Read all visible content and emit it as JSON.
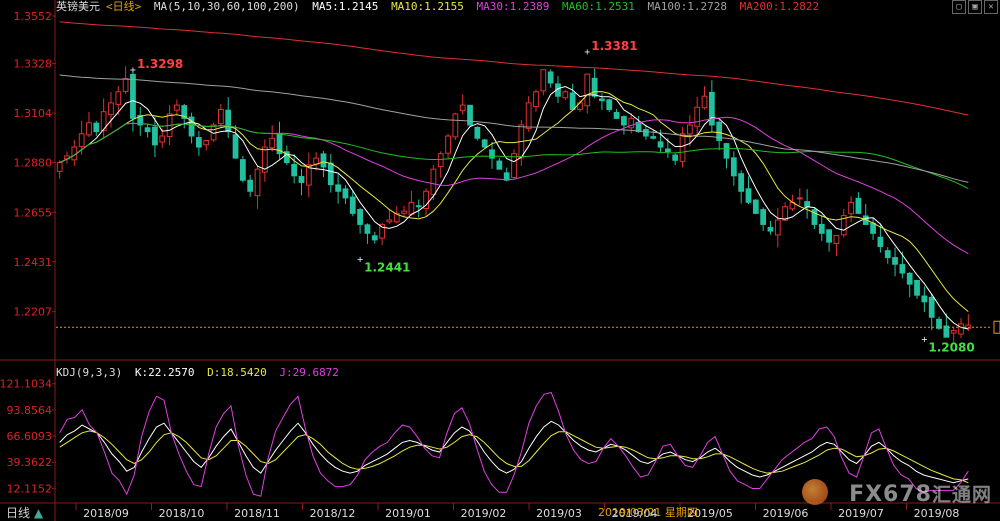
{
  "window": {
    "instrument": "英镑美元",
    "period": "<日线>",
    "controls": [
      "▢",
      "▣",
      "✕"
    ]
  },
  "ma_legend": {
    "header": "MA(5,10,30,60,100,200)",
    "items": [
      {
        "label": "MA5:1.2145",
        "color": "#ffffff"
      },
      {
        "label": "MA10:1.2155",
        "color": "#e8e840"
      },
      {
        "label": "MA30:1.2389",
        "color": "#e040e0"
      },
      {
        "label": "MA60:1.2531",
        "color": "#20c020"
      },
      {
        "label": "MA100:1.2728",
        "color": "#a0a0a0"
      },
      {
        "label": "MA200:1.2822",
        "color": "#e03030"
      }
    ]
  },
  "kdj_legend": {
    "header": "KDJ(9,3,3)",
    "items": [
      {
        "label": "K:22.2570",
        "color": "#ffffff"
      },
      {
        "label": "D:18.5420",
        "color": "#e8e840"
      },
      {
        "label": "J:29.6872",
        "color": "#e040e0"
      }
    ]
  },
  "bottom_bar": {
    "period_label": "日线",
    "cursor_date": "2019/03/21",
    "cursor_weekday": "星期四"
  },
  "watermark": {
    "text": "FX678",
    "cn": "汇通网"
  },
  "chart_data": [
    {
      "type": "candlestick",
      "title": "英镑美元",
      "y_ticks": [
        1.3552,
        1.3328,
        1.3104,
        1.288,
        1.2655,
        1.2431,
        1.2207
      ],
      "ylim": [
        1.205,
        1.3552
      ],
      "x_ticks": [
        "2018/09",
        "2018/10",
        "2018/11",
        "2018/12",
        "2019/01",
        "2019/02",
        "2019/03",
        "2019/04",
        "2019/05",
        "2019/06",
        "2019/07",
        "2019/08"
      ],
      "annotations": [
        {
          "label": "1.3298",
          "date": "2018/09 end",
          "type": "high"
        },
        {
          "label": "1.2441",
          "date": "2019/01 start",
          "type": "low"
        },
        {
          "label": "1.3381",
          "date": "2019/03 mid",
          "type": "high"
        },
        {
          "label": "1.2080",
          "date": "2019/08",
          "type": "low"
        }
      ],
      "current_price_line": 1.2135,
      "close": [
        1.288,
        1.291,
        1.295,
        1.301,
        1.306,
        1.302,
        1.311,
        1.315,
        1.32,
        1.326,
        1.308,
        1.305,
        1.302,
        1.296,
        1.3,
        1.31,
        1.314,
        1.308,
        1.3,
        1.295,
        1.298,
        1.305,
        1.312,
        1.302,
        1.29,
        1.28,
        1.275,
        1.285,
        1.295,
        1.299,
        1.292,
        1.288,
        1.282,
        1.279,
        1.287,
        1.29,
        1.286,
        1.278,
        1.275,
        1.272,
        1.265,
        1.26,
        1.256,
        1.253,
        1.26,
        1.262,
        1.265,
        1.266,
        1.27,
        1.268,
        1.275,
        1.285,
        1.292,
        1.3,
        1.31,
        1.314,
        1.305,
        1.299,
        1.295,
        1.29,
        1.285,
        1.28,
        1.292,
        1.305,
        1.315,
        1.32,
        1.33,
        1.324,
        1.318,
        1.32,
        1.312,
        1.315,
        1.328,
        1.318,
        1.316,
        1.312,
        1.308,
        1.305,
        1.308,
        1.302,
        1.3,
        1.299,
        1.295,
        1.293,
        1.289,
        1.301,
        1.305,
        1.313,
        1.318,
        1.305,
        1.298,
        1.29,
        1.282,
        1.275,
        1.27,
        1.265,
        1.26,
        1.257,
        1.262,
        1.268,
        1.27,
        1.272,
        1.268,
        1.26,
        1.256,
        1.252,
        1.255,
        1.264,
        1.27,
        1.265,
        1.26,
        1.256,
        1.25,
        1.245,
        1.242,
        1.238,
        1.233,
        1.228,
        1.225,
        1.218,
        1.213,
        1.209,
        1.212,
        1.215,
        1.2145
      ]
    },
    {
      "type": "line",
      "title": "KDJ(9,3,3)",
      "y_ticks": [
        121.1034,
        93.8564,
        66.6093,
        39.3622,
        12.1152
      ],
      "ylim": [
        0,
        125
      ],
      "series": [
        {
          "name": "K",
          "color": "#ffffff",
          "values": [
            60,
            68,
            72,
            78,
            74,
            70,
            60,
            48,
            40,
            30,
            34,
            50,
            64,
            76,
            80,
            70,
            60,
            50,
            40,
            34,
            44,
            56,
            66,
            74,
            60,
            46,
            34,
            28,
            40,
            52,
            62,
            72,
            80,
            70,
            58,
            48,
            40,
            34,
            30,
            28,
            30,
            36,
            40,
            44,
            48,
            54,
            60,
            62,
            60,
            56,
            52,
            50,
            60,
            70,
            76,
            72,
            62,
            50,
            40,
            32,
            28,
            32,
            40,
            54,
            66,
            76,
            82,
            78,
            70,
            62,
            56,
            52,
            50,
            54,
            58,
            56,
            52,
            46,
            40,
            38,
            42,
            48,
            50,
            46,
            42,
            40,
            44,
            50,
            54,
            48,
            40,
            34,
            30,
            26,
            24,
            26,
            30,
            34,
            38,
            42,
            46,
            50,
            56,
            60,
            58,
            50,
            42,
            38,
            46,
            56,
            60,
            54,
            46,
            40,
            36,
            30,
            26,
            24,
            22,
            20,
            18,
            20,
            22
          ]
        },
        {
          "name": "D",
          "color": "#e8e840",
          "values": [
            55,
            60,
            65,
            70,
            72,
            70,
            65,
            58,
            50,
            42,
            38,
            42,
            50,
            60,
            68,
            70,
            66,
            60,
            52,
            44,
            42,
            46,
            54,
            62,
            62,
            56,
            48,
            40,
            38,
            42,
            50,
            58,
            66,
            68,
            64,
            58,
            50,
            44,
            38,
            34,
            32,
            33,
            35,
            38,
            42,
            46,
            51,
            55,
            57,
            57,
            55,
            53,
            55,
            60,
            66,
            68,
            66,
            60,
            52,
            44,
            38,
            35,
            35,
            41,
            50,
            59,
            67,
            71,
            71,
            67,
            63,
            59,
            55,
            54,
            55,
            56,
            55,
            52,
            48,
            44,
            43,
            44,
            46,
            46,
            45,
            43,
            43,
            45,
            48,
            48,
            45,
            41,
            37,
            33,
            30,
            28,
            29,
            30,
            33,
            36,
            39,
            43,
            47,
            52,
            54,
            53,
            49,
            45,
            46,
            49,
            53,
            54,
            51,
            47,
            43,
            39,
            35,
            31,
            28,
            25,
            22,
            21,
            18
          ]
        },
        {
          "name": "J",
          "color": "#e040e0",
          "values": [
            70,
            84,
            86,
            94,
            78,
            70,
            50,
            28,
            20,
            6,
            26,
            66,
            92,
            108,
            104,
            70,
            48,
            30,
            16,
            14,
            48,
            76,
            90,
            98,
            56,
            26,
            6,
            4,
            44,
            72,
            86,
            100,
            108,
            74,
            46,
            28,
            20,
            14,
            14,
            16,
            26,
            42,
            50,
            56,
            60,
            70,
            78,
            76,
            66,
            54,
            46,
            44,
            70,
            90,
            96,
            80,
            54,
            30,
            16,
            8,
            8,
            26,
            50,
            80,
            98,
            110,
            112,
            92,
            68,
            52,
            42,
            38,
            40,
            54,
            64,
            56,
            46,
            34,
            24,
            26,
            40,
            56,
            58,
            46,
            36,
            34,
            46,
            60,
            66,
            48,
            30,
            20,
            16,
            12,
            12,
            22,
            32,
            42,
            48,
            54,
            60,
            64,
            74,
            76,
            66,
            44,
            28,
            24,
            46,
            70,
            74,
            54,
            36,
            26,
            22,
            12,
            8,
            10,
            10,
            10,
            10,
            18,
            30
          ]
        }
      ]
    }
  ]
}
